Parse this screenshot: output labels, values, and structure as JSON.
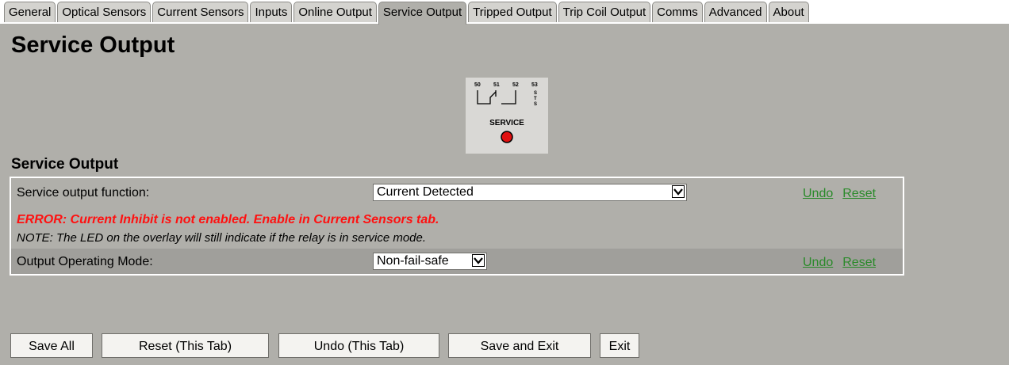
{
  "tabs": [
    {
      "label": "General"
    },
    {
      "label": "Optical Sensors"
    },
    {
      "label": "Current Sensors"
    },
    {
      "label": "Inputs"
    },
    {
      "label": "Online Output"
    },
    {
      "label": "Service Output",
      "active": true
    },
    {
      "label": "Tripped Output"
    },
    {
      "label": "Trip Coil Output"
    },
    {
      "label": "Comms"
    },
    {
      "label": "Advanced"
    },
    {
      "label": "About"
    }
  ],
  "page": {
    "title": "Service Output"
  },
  "relay_image": {
    "terminals": [
      "50",
      "51",
      "52",
      "53"
    ],
    "side_label": "STS",
    "caption": "SERVICE",
    "led_color": "#e01010"
  },
  "section": {
    "title": "Service Output"
  },
  "settings": {
    "function": {
      "label": "Service output function:",
      "value": "Current Detected",
      "undo": "Undo",
      "reset": "Reset"
    },
    "error": "ERROR: Current Inhibit is not enabled. Enable in Current Sensors tab.",
    "note": "NOTE: The LED on the overlay will still indicate if the relay is in service mode.",
    "mode": {
      "label": "Output Operating Mode:",
      "value": "Non-fail-safe",
      "undo": "Undo",
      "reset": "Reset"
    }
  },
  "buttons": {
    "save_all": "Save All",
    "reset_tab": "Reset (This Tab)",
    "undo_tab": "Undo (This Tab)",
    "save_exit": "Save and Exit",
    "exit": "Exit"
  }
}
